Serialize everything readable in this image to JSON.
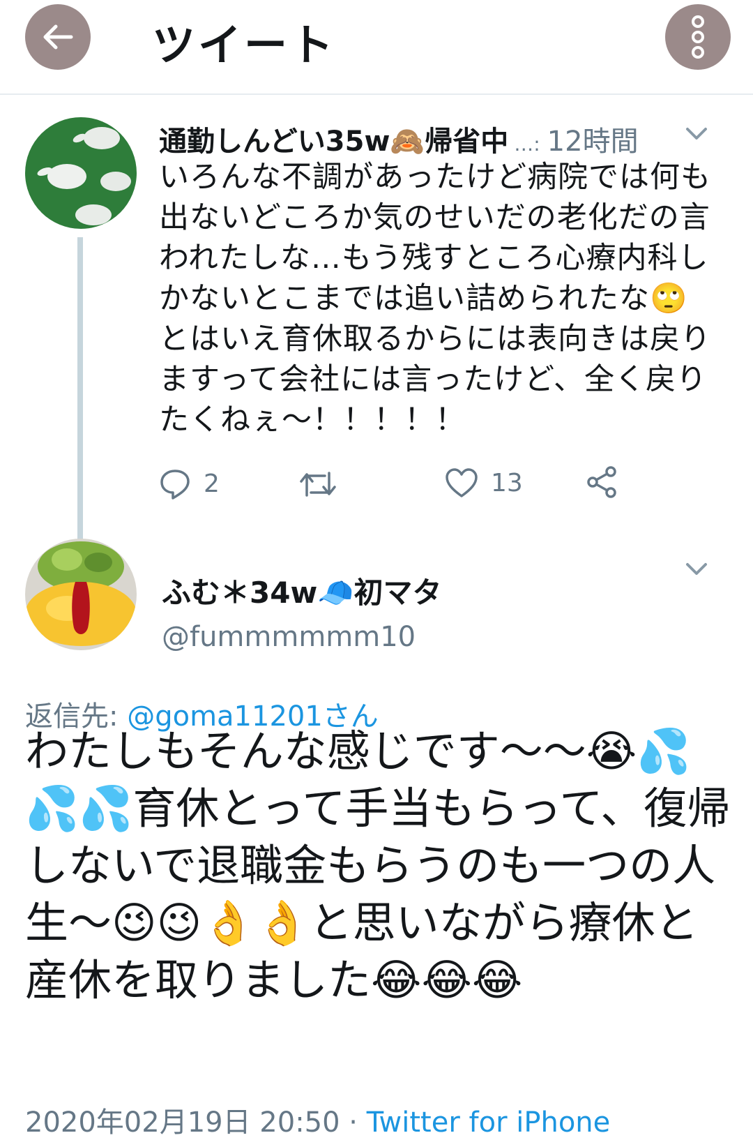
{
  "header": {
    "title": "ツイート",
    "back_icon": "arrow-left-icon",
    "more_icon": "more-vertical-icon"
  },
  "parent_tweet": {
    "display_name": "通勤しんどい35w🙈帰省中",
    "ellipsis": "…:",
    "time": "12時間",
    "text": "いろんな不調があったけど病院では何も出ないどころか気のせいだの老化だの言われたしな…もう残すところ心療内科しかないとこまでは追い詰められたな🙄とはいえ育休取るからには表向きは戻りますって会社には言ったけど、全く戻りたくねぇ〜！！！！！",
    "reply_count": "2",
    "retweet_count": "",
    "like_count": "13"
  },
  "reply_tweet": {
    "display_name": "ふむ＊34w🧢初マタ",
    "handle": "@fummmmmm10",
    "reply_to_label": "返信先: ",
    "reply_to_handle": "@goma11201さん",
    "text": "わたしもそんな感じです〜〜😭💦💦💦育休とって手当もらって、復帰しないで退職金もらうのも一つの人生〜😉😉👌👌と思いながら療休と産休を取りました😂😂😂",
    "date": "2020年02月19日 20:50 · ",
    "client": "Twitter for iPhone"
  },
  "colors": {
    "accent": "#1b95e0",
    "muted": "#657786",
    "thread_line": "#c6d5dc",
    "header_button": "#9b8a8a"
  }
}
